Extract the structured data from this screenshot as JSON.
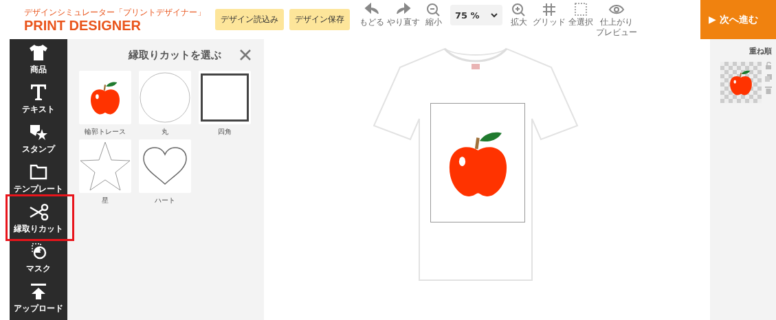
{
  "header": {
    "logo_tagline": "デザインシミュレーター「プリントデザイナー」",
    "logo": "PRINT DESIGNER",
    "buttons": [
      "デザイン読込み",
      "デザイン保存"
    ]
  },
  "toolbar": {
    "tools": [
      {
        "kind": "undo",
        "label": "もどる"
      },
      {
        "kind": "redo",
        "label": "やり直す"
      },
      {
        "kind": "zoom-out",
        "label": "縮小"
      },
      {
        "kind": "select",
        "value": "75 %"
      },
      {
        "kind": "zoom-in",
        "label": "拡大"
      },
      {
        "kind": "grid",
        "label": "グリッド"
      },
      {
        "kind": "select-all",
        "label": "全選択"
      },
      {
        "kind": "preview",
        "label_lines": [
          "仕上がり",
          "プレビュー"
        ]
      }
    ]
  },
  "next_button": "▶ 次へ進む",
  "sidebar": {
    "items": [
      {
        "kind": "product",
        "label": "商品",
        "highlighted": false
      },
      {
        "kind": "text",
        "label": "テキスト",
        "highlighted": false
      },
      {
        "kind": "stamp",
        "label": "スタンプ",
        "highlighted": false
      },
      {
        "kind": "template",
        "label": "テンプレート",
        "highlighted": false
      },
      {
        "kind": "cut",
        "label": "縁取りカット",
        "highlighted": true
      },
      {
        "kind": "mask",
        "label": "マスク",
        "highlighted": false
      },
      {
        "kind": "upload",
        "label": "アップロード",
        "highlighted": false
      }
    ]
  },
  "panel": {
    "title": "縁取りカットを選ぶ",
    "options": [
      {
        "kind": "trace",
        "label": "輪郭トレース"
      },
      {
        "kind": "circle",
        "label": "丸"
      },
      {
        "kind": "square",
        "label": "四角"
      },
      {
        "kind": "star",
        "label": "星"
      },
      {
        "kind": "heart",
        "label": "ハート"
      }
    ]
  },
  "layers": {
    "title": "重ね順"
  }
}
